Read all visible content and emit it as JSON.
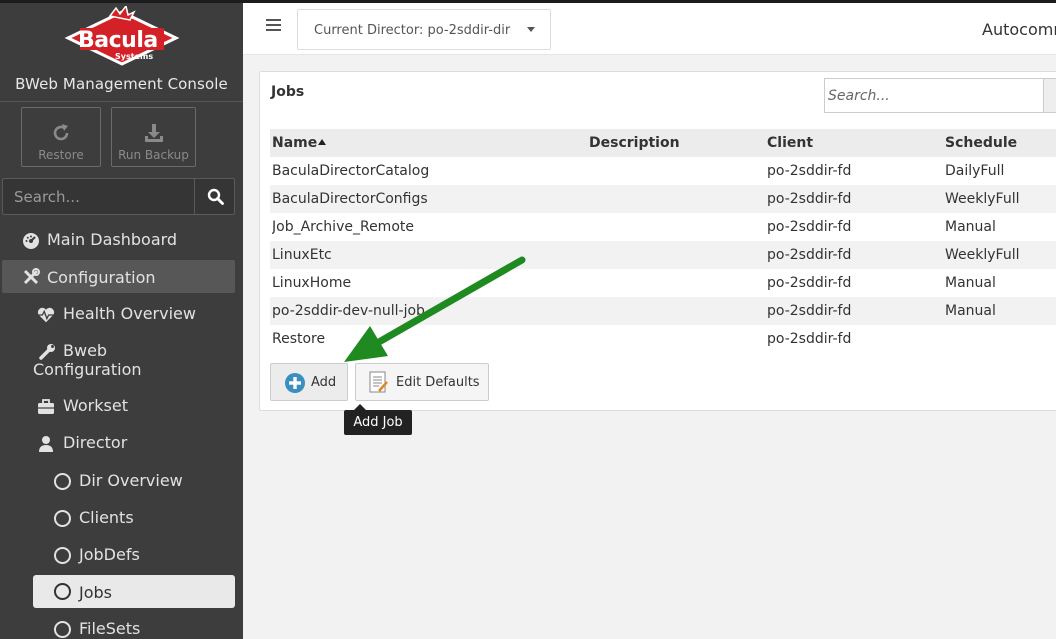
{
  "sidebar": {
    "logo_text": "Bacula",
    "logo_subtext": "Systems",
    "console_title": "BWeb Management Console",
    "restore_label": "Restore",
    "run_backup_label": "Run Backup",
    "search_placeholder": "Search...",
    "nav": {
      "main_dashboard": "Main Dashboard",
      "configuration": "Configuration",
      "health_overview": "Health Overview",
      "bweb_config_line1": "Bweb",
      "bweb_config_line2": "Configuration",
      "workset": "Workset",
      "director": "Director",
      "dir_overview": "Dir Overview",
      "clients": "Clients",
      "jobdefs": "JobDefs",
      "jobs": "Jobs",
      "filesets": "FileSets"
    }
  },
  "header": {
    "director_label": "Current Director: po-2sddir-dir",
    "autocomm": "Autocomm"
  },
  "panel": {
    "title": "Jobs",
    "search_placeholder": "Search...",
    "columns": [
      "Name",
      "Description",
      "Client",
      "Schedule"
    ],
    "rows": [
      {
        "name": "BaculaDirectorCatalog",
        "description": "",
        "client": "po-2sddir-fd",
        "schedule": "DailyFull"
      },
      {
        "name": "BaculaDirectorConfigs",
        "description": "",
        "client": "po-2sddir-fd",
        "schedule": "WeeklyFull"
      },
      {
        "name": "Job_Archive_Remote",
        "description": "",
        "client": "po-2sddir-fd",
        "schedule": "Manual"
      },
      {
        "name": "LinuxEtc",
        "description": "",
        "client": "po-2sddir-fd",
        "schedule": "WeeklyFull"
      },
      {
        "name": "LinuxHome",
        "description": "",
        "client": "po-2sddir-fd",
        "schedule": "Manual"
      },
      {
        "name": "po-2sddir-dev-null-job",
        "description": "",
        "client": "po-2sddir-fd",
        "schedule": "Manual"
      },
      {
        "name": "Restore",
        "description": "",
        "client": "po-2sddir-fd",
        "schedule": ""
      }
    ],
    "add_label": "Add",
    "edit_defaults_label": "Edit Defaults",
    "tooltip": "Add Job"
  },
  "colors": {
    "sidebar_bg": "#3d3d3d",
    "accent_arrow": "#1f8a1f",
    "logo_red": "#d42027",
    "add_icon": "#3a8fc1"
  }
}
